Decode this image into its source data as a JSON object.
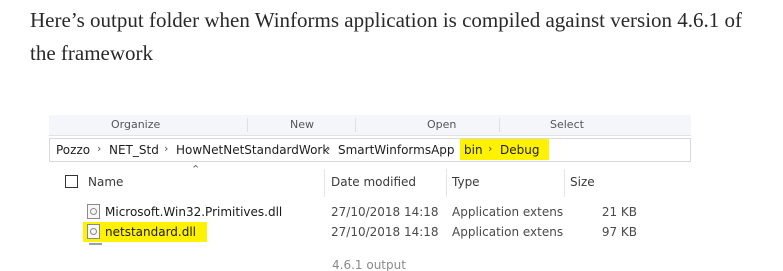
{
  "intro_text": "Here’s output folder when Winforms application is compiled against version 4.6.1 of the framework",
  "ribbon": {
    "groups": [
      "Organize",
      "New",
      "Open",
      "Select"
    ]
  },
  "breadcrumb": [
    "Pozzo",
    "NET_Std",
    "HowNetNetStandardWork",
    "SmartWinformsApp",
    "bin",
    "Debug"
  ],
  "breadcrumb_separator": "›",
  "columns": {
    "name": "Name",
    "date_modified": "Date modified",
    "type": "Type",
    "size": "Size"
  },
  "files": [
    {
      "name": "Microsoft.Win32.Primitives.dll",
      "date_modified": "27/10/2018 14:18",
      "type": "Application extens",
      "size": "21 KB",
      "icon": "dll-file-icon",
      "highlighted": false
    },
    {
      "name": "netstandard.dll",
      "date_modified": "27/10/2018 14:18",
      "type": "Application extens",
      "size": "97 KB",
      "icon": "dll-file-icon",
      "highlighted": true
    }
  ],
  "highlight_color": "#fff200",
  "caption": "4.6.1 output"
}
